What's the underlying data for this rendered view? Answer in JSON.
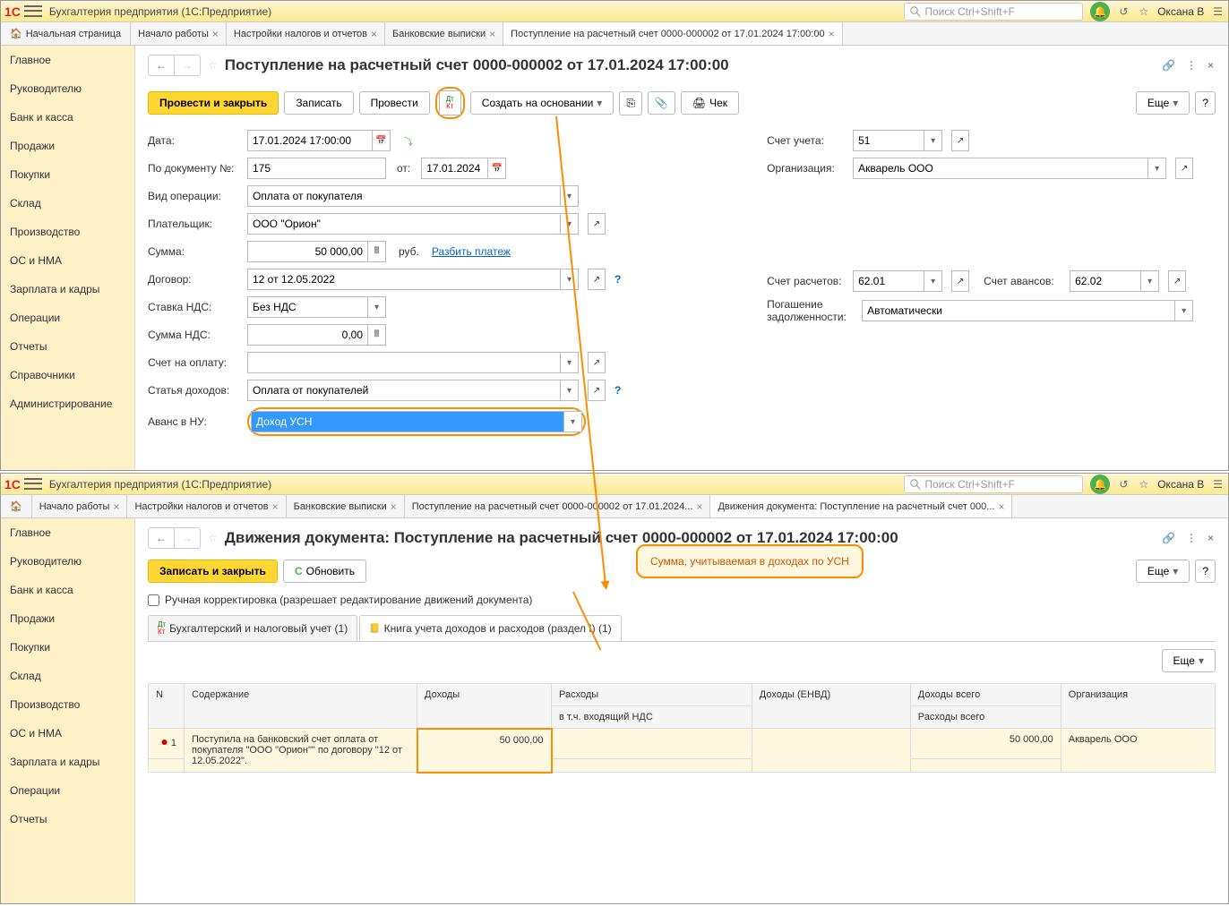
{
  "app": {
    "title": "Бухгалтерия предприятия  (1С:Предприятие)",
    "search_placeholder": "Поиск Ctrl+Shift+F",
    "user": "Оксана В"
  },
  "tabs1": {
    "home": "Начальная страница",
    "t1": "Начало работы",
    "t2": "Настройки налогов и отчетов",
    "t3": "Банковские выписки",
    "t4": "Поступление на расчетный счет 0000-000002 от 17.01.2024 17:00:00"
  },
  "sidebar": [
    "Главное",
    "Руководителю",
    "Банк и касса",
    "Продажи",
    "Покупки",
    "Склад",
    "Производство",
    "ОС и НМА",
    "Зарплата и кадры",
    "Операции",
    "Отчеты",
    "Справочники",
    "Администрирование"
  ],
  "sidebar2": [
    "Главное",
    "Руководителю",
    "Банк и касса",
    "Продажи",
    "Покупки",
    "Склад",
    "Производство",
    "ОС и НМА",
    "Зарплата и кадры",
    "Операции",
    "Отчеты"
  ],
  "page1": {
    "title": "Поступление на расчетный счет 0000-000002 от 17.01.2024 17:00:00",
    "btn_post_close": "Провести и закрыть",
    "btn_write": "Записать",
    "btn_post": "Провести",
    "btn_base": "Создать на основании",
    "btn_check": "Чек",
    "btn_more": "Еще",
    "labels": {
      "date": "Дата:",
      "doc_no": "По документу №:",
      "from": "от:",
      "op_type": "Вид операции:",
      "payer": "Плательщик:",
      "sum": "Сумма:",
      "contract": "Договор:",
      "vat_rate": "Ставка НДС:",
      "vat_sum": "Сумма НДС:",
      "invoice": "Счет на оплату:",
      "income_item": "Статья доходов:",
      "advance_nu": "Аванс в НУ:",
      "account": "Счет учета:",
      "org": "Организация:",
      "calc_account": "Счет расчетов:",
      "adv_account": "Счет авансов:",
      "debt": "Погашение задолженности:",
      "rub": "руб.",
      "split": "Разбить платеж"
    },
    "values": {
      "date": "17.01.2024 17:00:00",
      "doc_no": "175",
      "from": "17.01.2024",
      "op_type": "Оплата от покупателя",
      "payer": "ООО \"Орион\"",
      "sum": "50 000,00",
      "contract": "12 от 12.05.2022",
      "vat_rate": "Без НДС",
      "vat_sum": "0,00",
      "income_item": "Оплата от покупателей",
      "advance_nu": "Доход УСН",
      "account": "51",
      "org": "Акварель ООО",
      "calc_account": "62.01",
      "adv_account": "62.02",
      "debt": "Автоматически"
    }
  },
  "tabs2_bar": {
    "home_blank": "",
    "t1": "Начало работы",
    "t2": "Настройки налогов и отчетов",
    "t3": "Банковские выписки",
    "t4": "Поступление на расчетный счет 0000-000002 от 17.01.2024...",
    "t5": "Движения документа: Поступление на расчетный счет 000..."
  },
  "page2": {
    "title": "Движения документа: Поступление на расчетный счет 0000-000002 от 17.01.2024 17:00:00",
    "btn_write_close": "Записать и закрыть",
    "btn_refresh": "Обновить",
    "btn_more": "Еще",
    "checkbox": "Ручная корректировка (разрешает редактирование движений документа)",
    "tab1": "Бухгалтерский и налоговый учет (1)",
    "tab2": "Книга учета доходов и расходов (раздел I) (1)",
    "headers": {
      "n": "N",
      "content": "Содержание",
      "income": "Доходы",
      "expense": "Расходы",
      "income_envd": "Доходы (ЕНВД)",
      "income_total": "Доходы всего",
      "org": "Организация",
      "incl_vat": "в т.ч. входящий НДС",
      "expense_total": "Расходы всего"
    },
    "row": {
      "n": "1",
      "content": "Поступила на банковский счет оплата от покупателя \"ООО \"Орион\"\" по договору \"12 от 12.05.2022\".",
      "income": "50 000,00",
      "income_total": "50 000,00",
      "org": "Акварель ООО"
    }
  },
  "callout": "Сумма, учитываемая в доходах по УСН"
}
